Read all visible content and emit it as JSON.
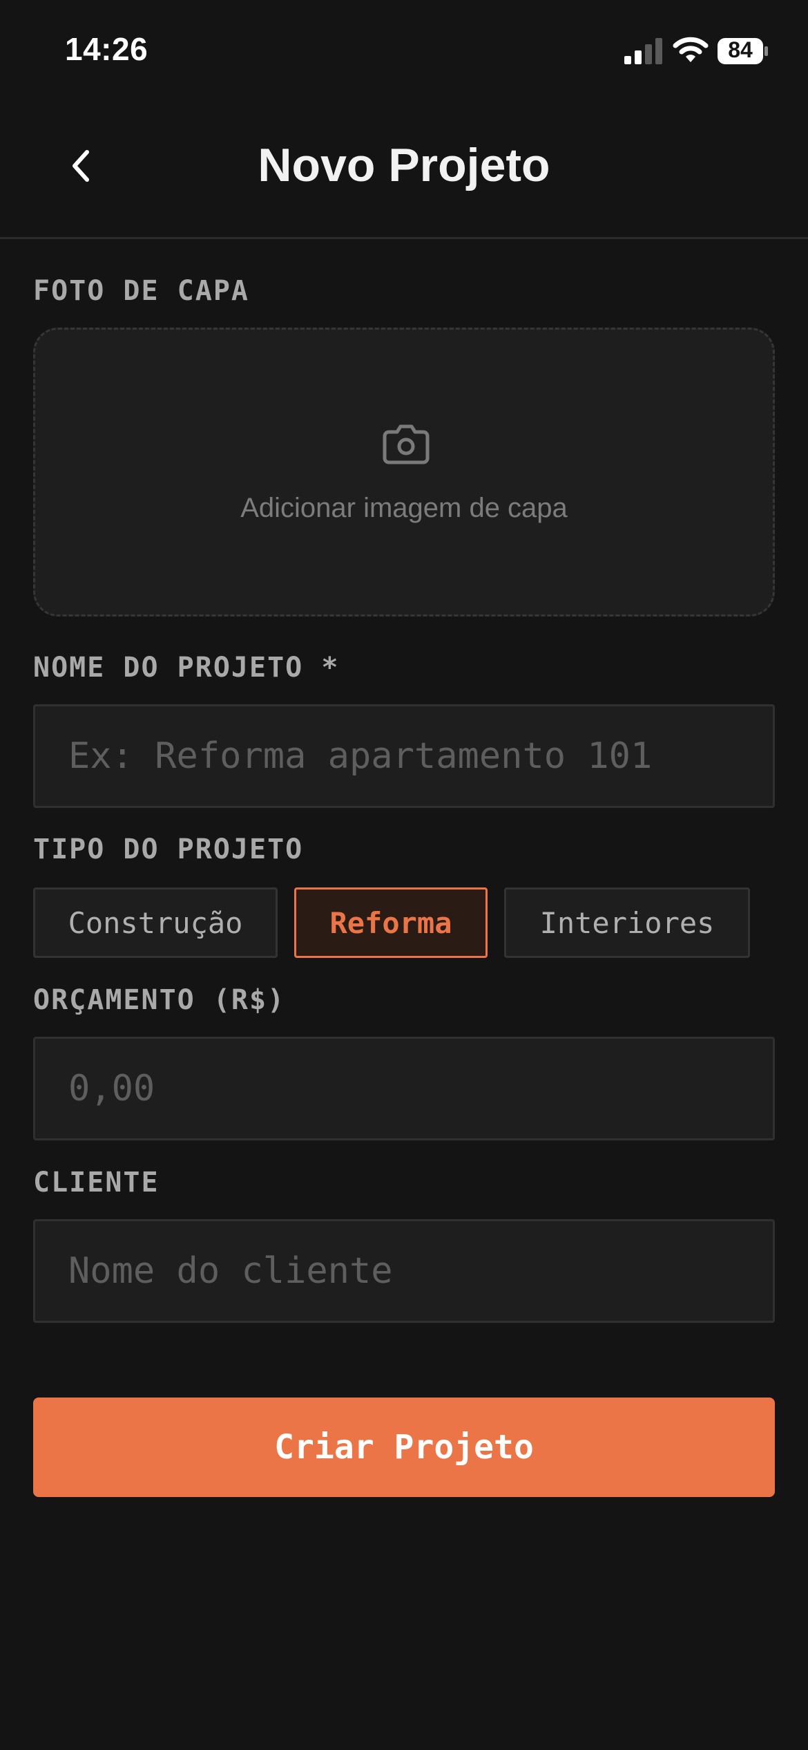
{
  "status_bar": {
    "time": "14:26",
    "battery": "84"
  },
  "nav": {
    "back_icon": "chevron-left-icon",
    "title": "Novo Projeto"
  },
  "form": {
    "cover": {
      "label": "FOTO DE CAPA",
      "icon": "camera-icon",
      "placeholder_text": "Adicionar imagem de capa"
    },
    "project_name": {
      "label": "NOME DO PROJETO *",
      "placeholder": "Ex: Reforma apartamento 101",
      "value": ""
    },
    "project_type": {
      "label": "TIPO DO PROJETO",
      "options": [
        "Construção",
        "Reforma",
        "Interiores"
      ],
      "selected": "Reforma"
    },
    "budget": {
      "label": "ORÇAMENTO (R$)",
      "placeholder": "0,00",
      "value": ""
    },
    "client": {
      "label": "CLIENTE",
      "placeholder": "Nome do cliente",
      "value": ""
    },
    "submit_label": "Criar Projeto"
  },
  "colors": {
    "background": "#141414",
    "surface": "#1e1e1e",
    "accent": "#ec7547",
    "label": "#a9a9a9"
  }
}
